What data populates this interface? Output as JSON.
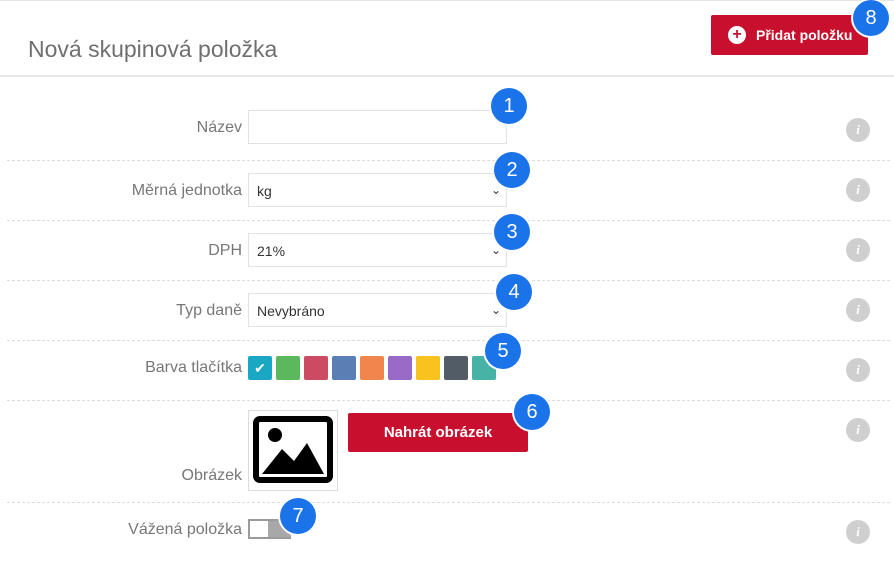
{
  "header": {
    "title": "Nová skupinová položka",
    "add_button_label": "Přidat položku",
    "add_button_icon": "plus-circle-icon"
  },
  "form": {
    "name": {
      "label": "Název",
      "value": "",
      "placeholder": ""
    },
    "unit": {
      "label": "Měrná jednotka",
      "selected": "kg"
    },
    "vat": {
      "label": "DPH",
      "selected": "21%"
    },
    "tax_type": {
      "label": "Typ daně",
      "selected": "Nevybráno"
    },
    "button_color": {
      "label": "Barva tlačítka",
      "colors": [
        "#1aa7c4",
        "#5cb85c",
        "#cc4b63",
        "#5b7fb5",
        "#f0854e",
        "#9a6bc6",
        "#f8c31f",
        "#525c66",
        "#46b3a6"
      ],
      "selected_index": 0
    },
    "image": {
      "label": "Obrázek",
      "upload_label": "Nahrát obrázek"
    },
    "weighted": {
      "label": "Vážená položka",
      "enabled": false
    }
  },
  "badges": [
    "1",
    "2",
    "3",
    "4",
    "5",
    "6",
    "7",
    "8"
  ],
  "info_glyph": "i",
  "accent": "#c8102e",
  "badge_color": "#1a73e8"
}
